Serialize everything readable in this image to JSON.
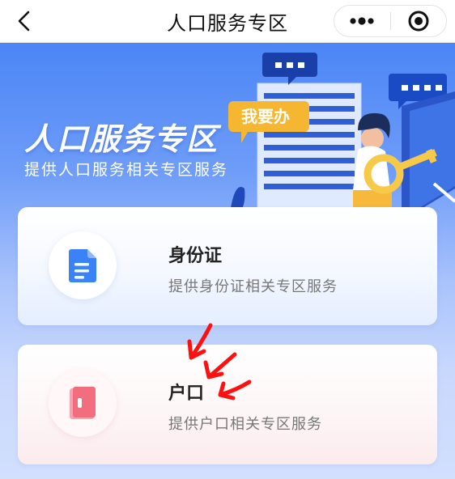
{
  "nav": {
    "title": "人口服务专区"
  },
  "banner": {
    "title": "人口服务专区",
    "subtitle": "提供人口服务相关专区服务",
    "badge": "我要办"
  },
  "cards": [
    {
      "title": "身份证",
      "description": "提供身份证相关专区服务",
      "icon": "document-icon",
      "accent": "#3a82f7"
    },
    {
      "title": "户口",
      "description": "提供户口相关专区服务",
      "icon": "household-book-icon",
      "accent": "#f26d7d"
    }
  ],
  "colors": {
    "banner_top": "#4b85f6",
    "badge_yellow": "#f5b731",
    "annotation_red": "#ff1010"
  }
}
